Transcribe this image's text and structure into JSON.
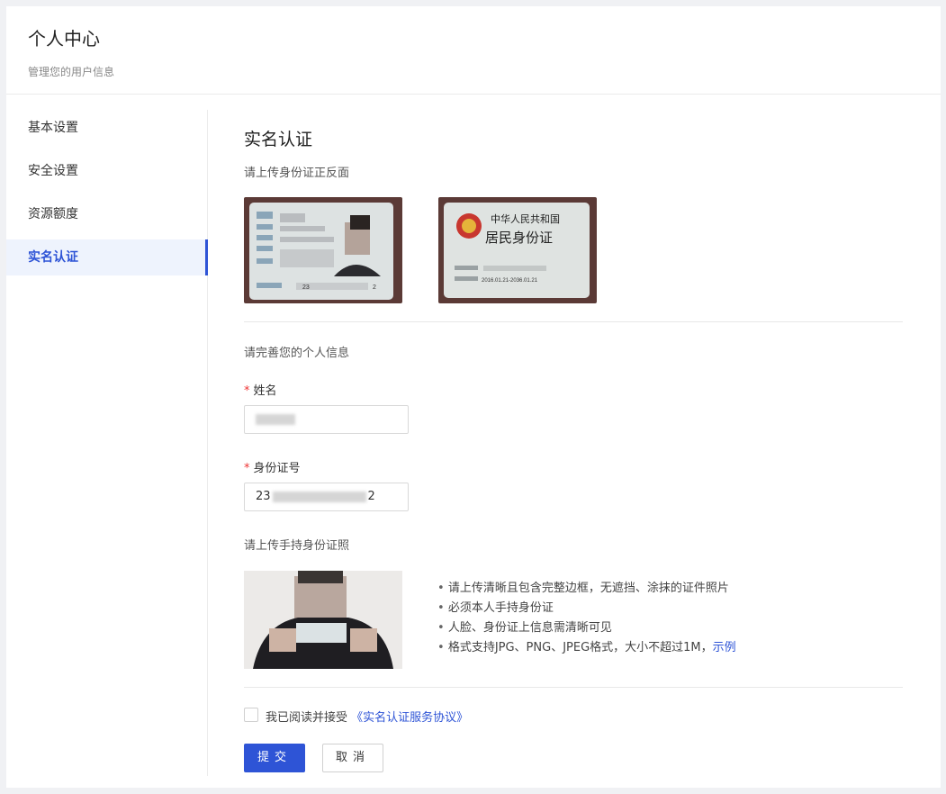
{
  "header": {
    "title": "个人中心",
    "subtitle": "管理您的用户信息"
  },
  "sidebar": {
    "items": [
      {
        "label": "基本设置",
        "active": false
      },
      {
        "label": "安全设置",
        "active": false
      },
      {
        "label": "资源额度",
        "active": false
      },
      {
        "label": "实名认证",
        "active": true
      }
    ]
  },
  "main": {
    "section_title": "实名认证",
    "upload_id_label": "请上传身份证正反面",
    "id_back": {
      "line1": "中华人民共和国",
      "line2": "居民身份证",
      "validity": "2016.01.21-2036.01.21"
    },
    "id_front": {
      "number_prefix": "23",
      "number_suffix": "2"
    },
    "complete_info_label": "请完善您的个人信息",
    "name_label": "姓名",
    "id_number_label": "身份证号",
    "id_number_prefix": "23",
    "id_number_suffix": "2",
    "upload_hand_label": "请上传手持身份证照",
    "tips": [
      "请上传清晰且包含完整边框，无遮挡、涂抹的证件照片",
      "必须本人手持身份证",
      "人脸、身份证上信息需清晰可见",
      "格式支持JPG、PNG、JPEG格式，大小不超过1M，"
    ],
    "example_link": "示例",
    "agree_text": "我已阅读并接受",
    "agreement_link": "《实名认证服务协议》",
    "submit_label": "提交",
    "cancel_label": "取消"
  },
  "colors": {
    "accent": "#2e54d6",
    "required": "#e33333",
    "background": "#f0f1f4"
  }
}
